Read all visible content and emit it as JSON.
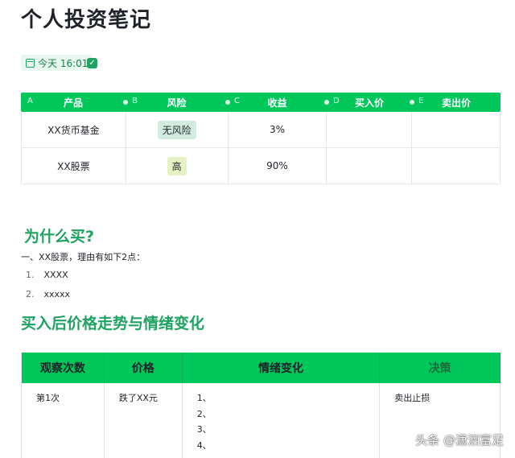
{
  "title": "个人投资笔记",
  "date_chip": {
    "icon": "calendar-icon",
    "text": "今天 16:01"
  },
  "checkbox": {
    "checked": true
  },
  "table1": {
    "headers": [
      {
        "letter": "A",
        "label": "产品"
      },
      {
        "letter": "B",
        "label": "风险"
      },
      {
        "letter": "C",
        "label": "收益"
      },
      {
        "letter": "D",
        "label": "买入价"
      },
      {
        "letter": "E",
        "label": "卖出价"
      }
    ],
    "rows": [
      {
        "product": "XX货币基金",
        "risk": "无风险",
        "return": "3%",
        "buy": "",
        "sell": ""
      },
      {
        "product": "XX股票",
        "risk": "高",
        "return": "90%",
        "buy": "",
        "sell": ""
      }
    ]
  },
  "section_why": {
    "heading": "为什么买?",
    "paragraph": "一、XX股票，理由有如下2点：",
    "items": [
      {
        "num": "1.",
        "text": "XXXX"
      },
      {
        "num": "2.",
        "text": "xxxxx"
      }
    ]
  },
  "section_trend": {
    "heading": "买入后价格走势与情绪变化"
  },
  "table2": {
    "headers": [
      "观察次数",
      "价格",
      "情绪变化",
      "决策"
    ],
    "rows": [
      {
        "count": "第1次",
        "price": "跌了XX元",
        "emotions": [
          "1、",
          "2、",
          "3、",
          "4、"
        ],
        "decision": "卖出止损"
      }
    ]
  },
  "watermark": "头条 @潇洒富足",
  "colors": {
    "accent": "#00c75a",
    "heading_green": "#1fa362"
  }
}
